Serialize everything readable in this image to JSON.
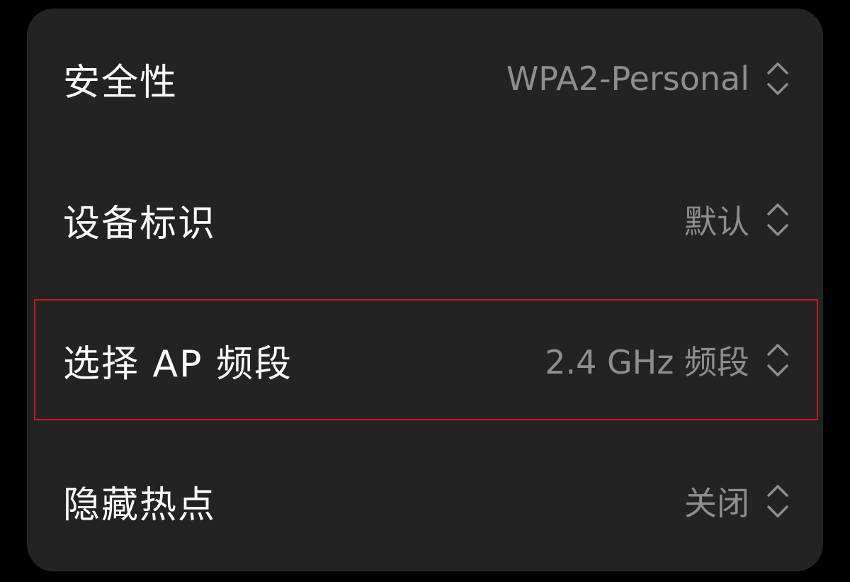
{
  "settings": {
    "rows": [
      {
        "label": "安全性",
        "value": "WPA2-Personal",
        "icon": "chevron-up-down-icon"
      },
      {
        "label": "设备标识",
        "value": "默认",
        "icon": "chevron-up-down-icon"
      },
      {
        "label": "选择 AP 频段",
        "value": "2.4 GHz 频段",
        "icon": "chevron-up-down-icon"
      },
      {
        "label": "隐藏热点",
        "value": "关闭",
        "icon": "chevron-up-down-icon"
      }
    ]
  },
  "colors": {
    "background": "#000000",
    "card": "#232323",
    "label": "#ffffff",
    "value": "#8e8e8e",
    "highlight_border": "#d0131b"
  }
}
